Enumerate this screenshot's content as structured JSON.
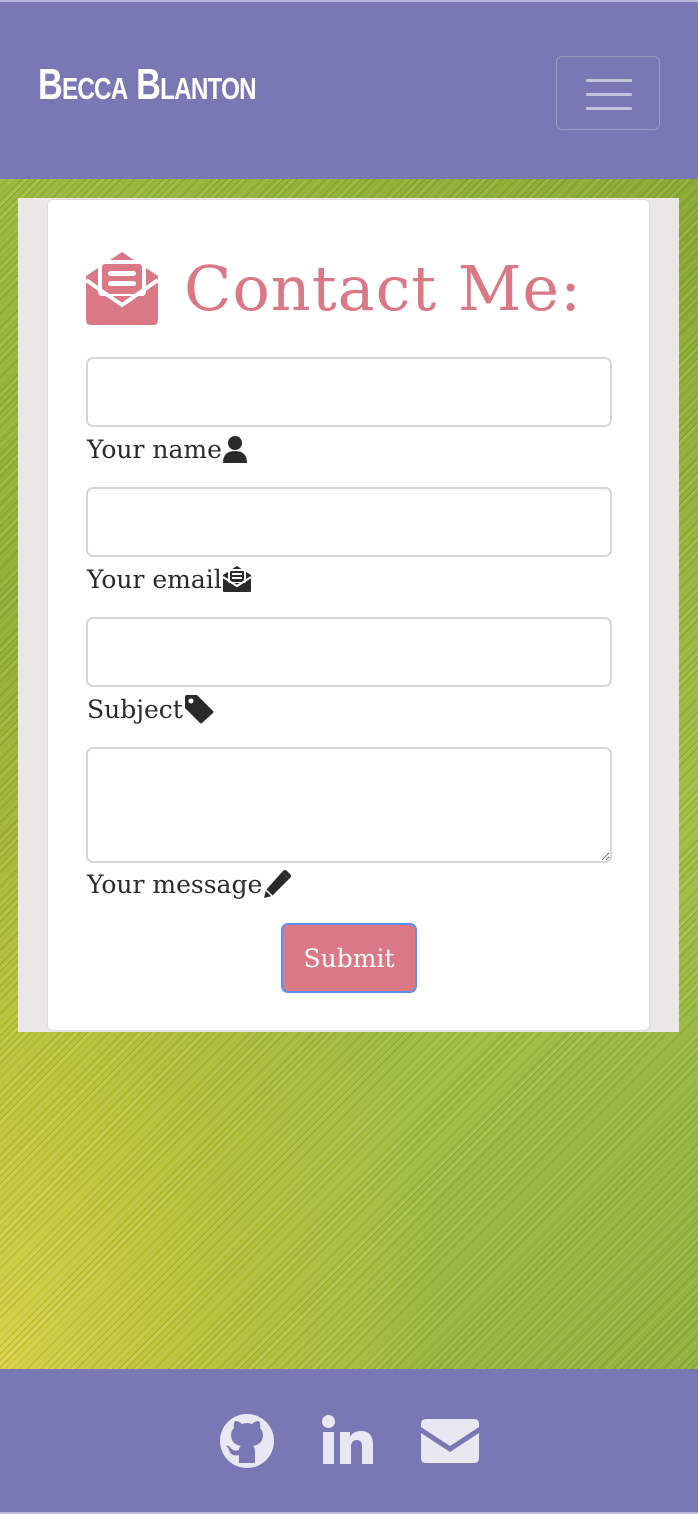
{
  "navbar": {
    "brand": "Becca Blanton",
    "toggler_icon": "hamburger-menu-icon",
    "bg_color": "#7a78b4"
  },
  "contact": {
    "heading": "Contact Me:",
    "heading_icon": "envelope-open-text-icon",
    "accent_color": "#db7886",
    "fields": [
      {
        "label": "Your name",
        "icon": "user-icon",
        "value": "",
        "placeholder": ""
      },
      {
        "label": "Your email",
        "icon": "envelope-open-text-icon",
        "value": "",
        "placeholder": ""
      },
      {
        "label": "Subject",
        "icon": "tag-icon",
        "value": "",
        "placeholder": ""
      },
      {
        "label": "Your message",
        "icon": "pencil-icon",
        "value": "",
        "placeholder": ""
      }
    ],
    "submit_label": "Submit"
  },
  "footer": {
    "icons": [
      "github-icon",
      "linkedin-icon",
      "envelope-icon"
    ]
  }
}
